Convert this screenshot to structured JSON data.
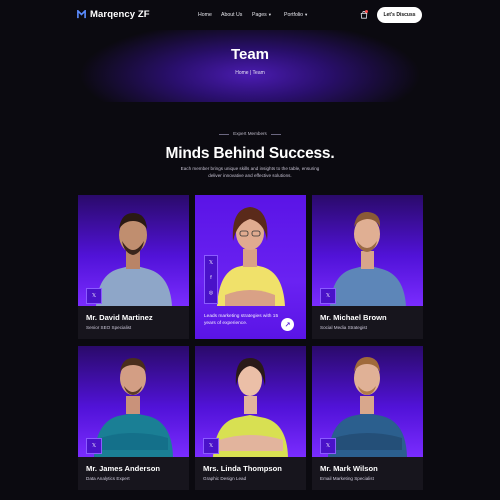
{
  "header": {
    "brand": "Marqency ZF",
    "nav": [
      {
        "label": "Home"
      },
      {
        "label": "About Us"
      },
      {
        "label": "Pages",
        "has_dropdown": true
      },
      {
        "label": "Portfolio",
        "has_dropdown": true
      }
    ],
    "cta_label": "Let's Discuss",
    "icons": [
      "logo-mark",
      "cart-icon"
    ]
  },
  "hero": {
    "title": "Team",
    "breadcrumb": "Home | Team"
  },
  "section": {
    "eyebrow": "Expert Members",
    "title": "Minds Behind Success.",
    "description": "Each member brings unique skills and insights to the table, ensuring deliver innovative and effective solutions."
  },
  "team": [
    {
      "name": "Mr. David Martinez",
      "role": "Senior SEO Specialist",
      "social_icon": "x-icon"
    },
    {
      "name": "",
      "role": "",
      "blurb": "Leads marketing strategies with 15 years of experience.",
      "social_icons": [
        "x-icon",
        "facebook-icon",
        "instagram-icon"
      ],
      "active": true
    },
    {
      "name": "Mr. Michael Brown",
      "role": "Social Media Strategist",
      "social_icon": "x-icon"
    },
    {
      "name": "Mr. James Anderson",
      "role": "Data Analytics Expert",
      "social_icon": "x-icon"
    },
    {
      "name": "Mrs. Linda Thompson",
      "role": "Graphic Design Lead",
      "social_icon": "x-icon"
    },
    {
      "name": "Mr. Mark Wilson",
      "role": "Email Marketing Specialist",
      "social_icon": "x-icon"
    }
  ],
  "colors": {
    "background": "#0b0a10",
    "accent": "#5112d8",
    "card": "#17151d",
    "cta_bg": "#ffffff"
  }
}
